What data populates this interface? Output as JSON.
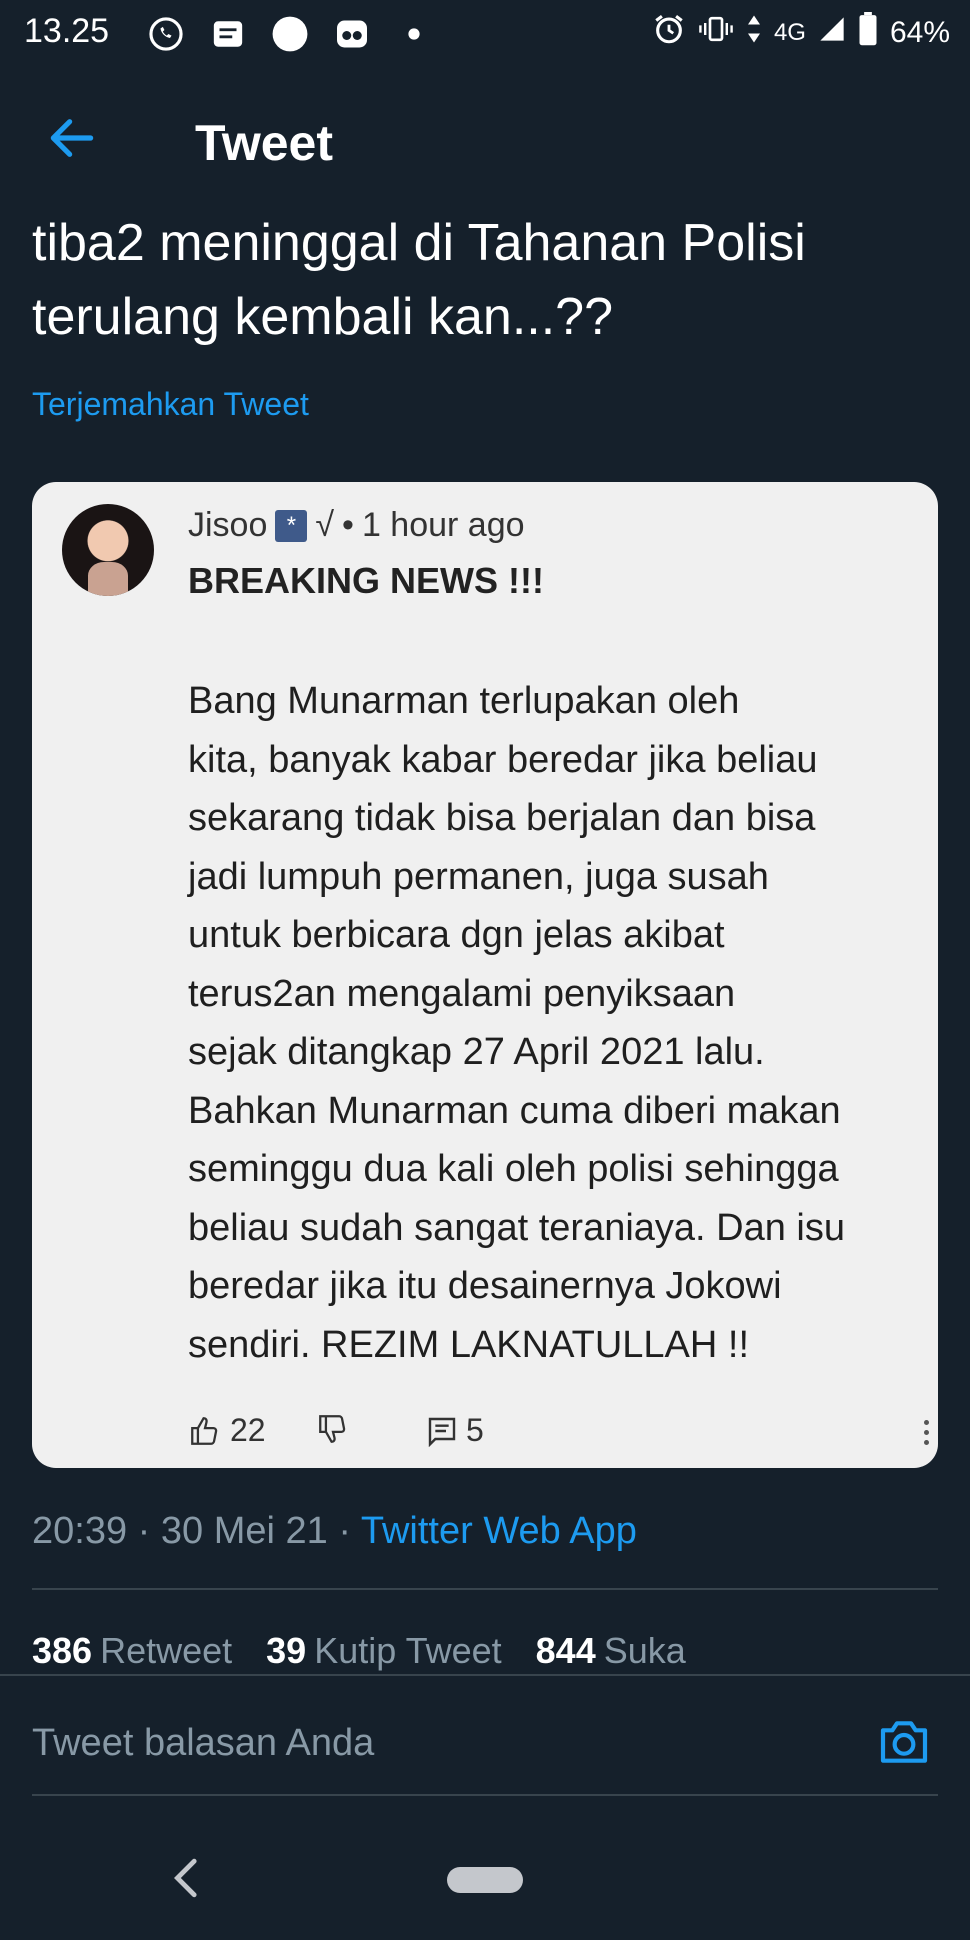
{
  "status_bar": {
    "time": "13.25",
    "network": "4G",
    "battery": "64%"
  },
  "header": {
    "title": "Tweet"
  },
  "tweet": {
    "text_line1": "tiba2 meninggal di Tahanan Polisi",
    "text_line2": "terulang kembali kan...??",
    "translate_label": "Terjemahkan Tweet",
    "time": "20:39",
    "date": "30 Mei 21",
    "source": "Twitter Web App"
  },
  "embedded": {
    "author": "Jisoo",
    "badge_glyph": "*",
    "check": "√",
    "age": "1 hour ago",
    "headline": "BREAKING NEWS !!!",
    "body": "Bang Munarman terlupakan oleh\nkita, banyak kabar beredar jika beliau\nsekarang tidak bisa berjalan dan bisa\njadi lumpuh permanen, juga susah\nuntuk berbicara dgn jelas akibat\nterus2an mengalami penyiksaan\nsejak ditangkap 27 April 2021 lalu.\nBahkan Munarman cuma diberi makan\nseminggu dua kali oleh polisi sehingga\nbeliau sudah sangat teraniaya. Dan isu\nberedar jika itu desainernya Jokowi\nsendiri. REZIM LAKNATULLAH !!",
    "likes": "22",
    "replies": "5"
  },
  "stats": {
    "retweets_count": "386",
    "retweets_label": "Retweet",
    "quotes_count": "39",
    "quotes_label": "Kutip Tweet",
    "likes_count": "844",
    "likes_label": "Suka"
  },
  "reply": {
    "placeholder": "Tweet balasan Anda"
  },
  "colors": {
    "background": "#15202b",
    "accent": "#1d9bf0",
    "muted": "#8899a6",
    "card": "#f0f0f0"
  },
  "icons": {
    "back": "arrow-left-icon",
    "camera": "camera-icon",
    "like": "thumbs-up-icon",
    "dislike": "thumbs-down-icon",
    "comment": "comment-icon",
    "more": "more-vertical-icon"
  }
}
